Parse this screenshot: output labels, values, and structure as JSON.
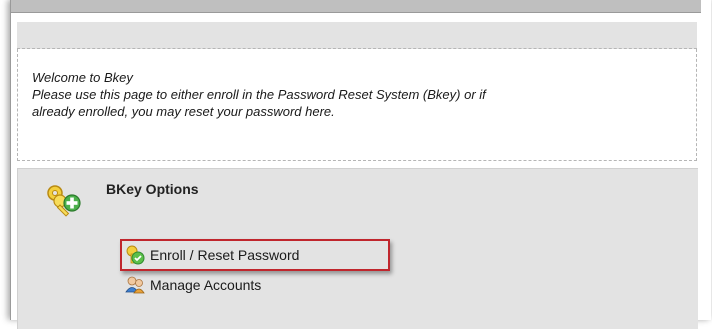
{
  "welcome": {
    "line1": "Welcome to Bkey",
    "line2": "Please use this page to either enroll in the Password Reset System (Bkey) or if",
    "line3": "already enrolled, you may reset your password here."
  },
  "options": {
    "title": "BKey Options",
    "icon": "keys-add-icon",
    "links": [
      {
        "label": "Enroll / Reset Password",
        "icon": "enroll-icon",
        "highlighted": true
      },
      {
        "label": "Manage Accounts",
        "icon": "users-icon",
        "highlighted": false
      }
    ]
  },
  "colors": {
    "highlight_border": "#c0262d",
    "panel_bg": "#e3e3e3"
  }
}
